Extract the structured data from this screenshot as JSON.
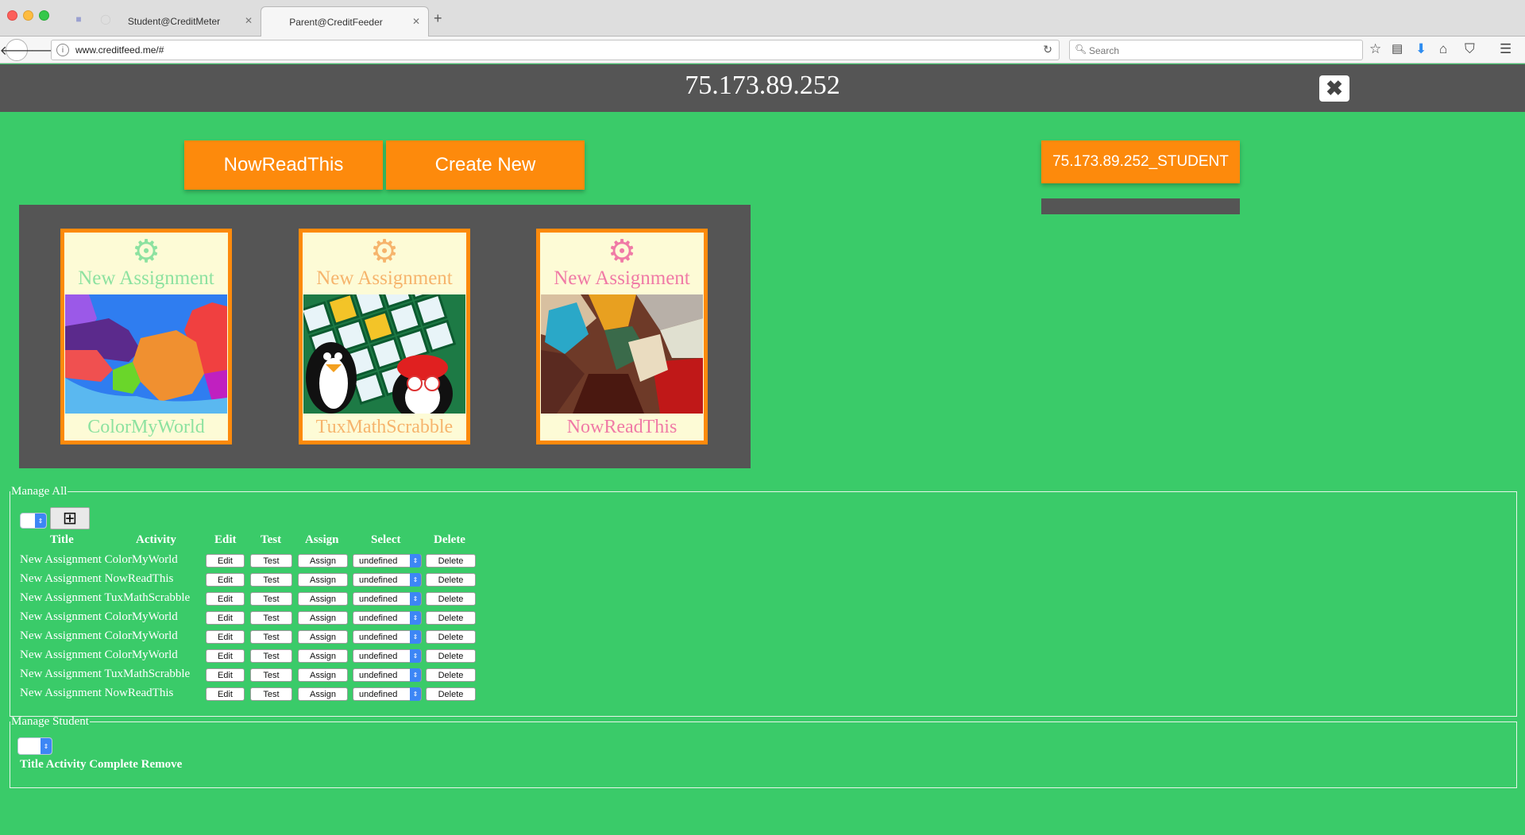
{
  "browser": {
    "tabs": [
      {
        "label": "Student@CreditMeter",
        "active": false
      },
      {
        "label": "Parent@CreditFeeder",
        "active": true
      }
    ],
    "url": "www.creditfeed.me/#",
    "search_placeholder": "Search"
  },
  "header": {
    "title": "75.173.89.252"
  },
  "toolbar": {
    "nowreadthis_label": "NowReadThis",
    "create_new_label": "Create New",
    "student_label": "75.173.89.252_STUDENT"
  },
  "gallery": {
    "cards": [
      {
        "title": "New Assignment",
        "name": "ColorMyWorld",
        "color": "#8de2a0",
        "gear_icon": "gear-icon"
      },
      {
        "title": "New Assignment",
        "name": "TuxMathScrabble",
        "color": "#f6b46c",
        "gear_icon": "gear-icon"
      },
      {
        "title": "New Assignment",
        "name": "NowReadThis",
        "color": "#f07aa6",
        "gear_icon": "gear-icon"
      }
    ]
  },
  "manage_all": {
    "legend": "Manage All",
    "add_icon": "plus-square-icon",
    "headers": {
      "title": "Title",
      "activity": "Activity",
      "edit": "Edit",
      "test": "Test",
      "assign": "Assign",
      "select": "Select",
      "delete": "Delete"
    },
    "row_buttons": {
      "edit": "Edit",
      "test": "Test",
      "assign": "Assign",
      "delete": "Delete"
    },
    "rows": [
      {
        "title": "New Assignment",
        "activity": "ColorMyWorld",
        "select": "undefined"
      },
      {
        "title": "New Assignment",
        "activity": "NowReadThis",
        "select": "undefined"
      },
      {
        "title": "New Assignment",
        "activity": "TuxMathScrabble",
        "select": "undefined"
      },
      {
        "title": "New Assignment",
        "activity": "ColorMyWorld",
        "select": "undefined"
      },
      {
        "title": "New Assignment",
        "activity": "ColorMyWorld",
        "select": "undefined"
      },
      {
        "title": "New Assignment",
        "activity": "ColorMyWorld",
        "select": "undefined"
      },
      {
        "title": "New Assignment",
        "activity": "TuxMathScrabble",
        "select": "undefined"
      },
      {
        "title": "New Assignment",
        "activity": "NowReadThis",
        "select": "undefined"
      }
    ]
  },
  "manage_student": {
    "legend": "Manage Student",
    "headers": "Title Activity Complete Remove"
  },
  "colors": {
    "page_bg": "#3acb69",
    "header_bg": "#555555",
    "accent": "#fd8a0c",
    "card_bg": "#fdfbd6"
  }
}
